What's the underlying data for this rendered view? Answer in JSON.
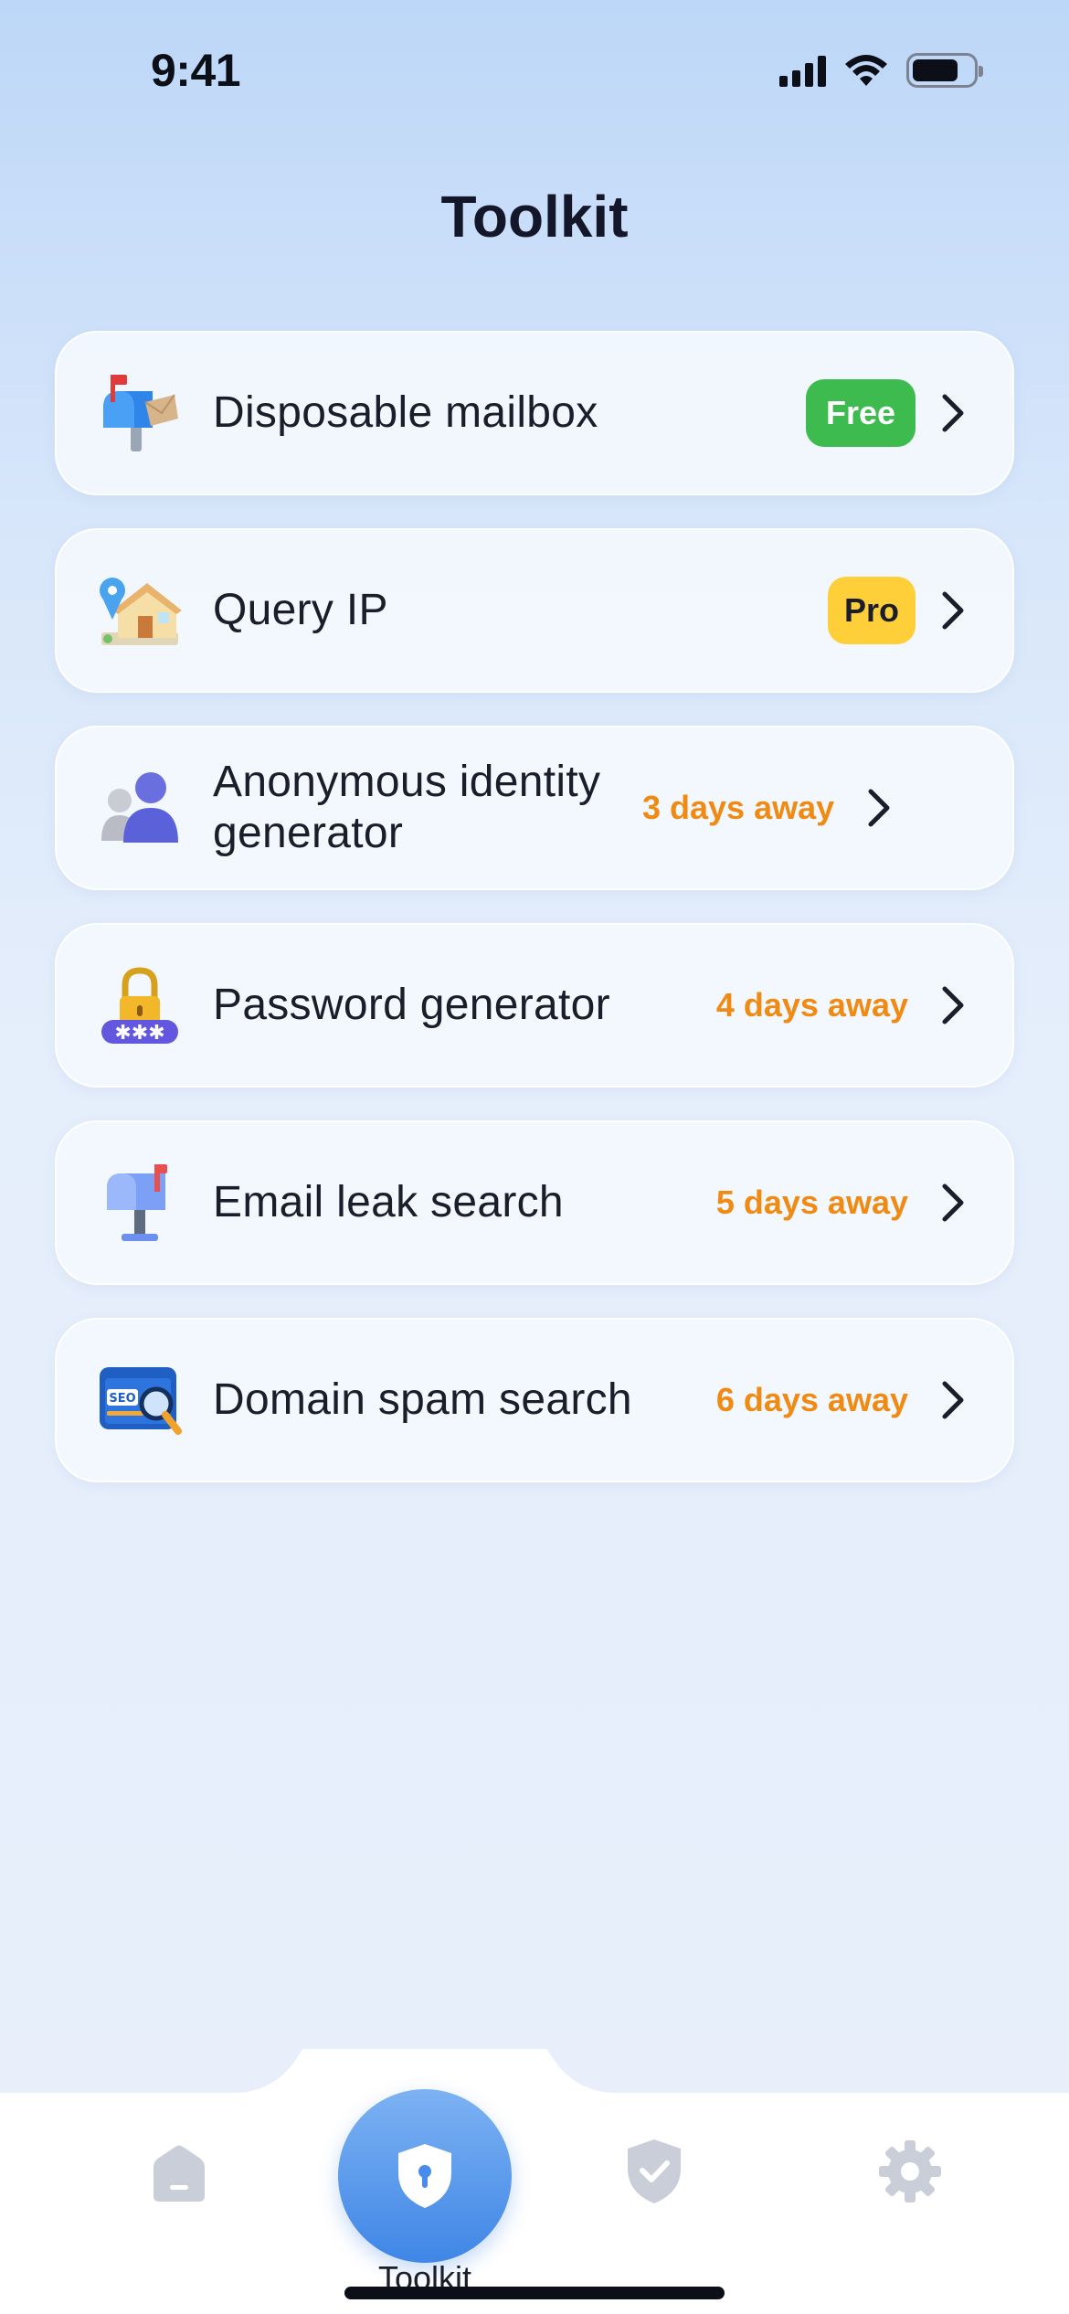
{
  "status_bar": {
    "time": "9:41"
  },
  "page": {
    "title": "Toolkit"
  },
  "tools": [
    {
      "label": "Disposable mailbox",
      "badge": "Free",
      "icon": "mailbox-icon"
    },
    {
      "label": "Query IP",
      "badge": "Pro",
      "icon": "house-location-icon"
    },
    {
      "label": "Anonymous identity generator",
      "status": "3 days away",
      "icon": "anonymous-people-icon"
    },
    {
      "label": "Password generator",
      "status": "4 days away",
      "icon": "padlock-password-icon"
    },
    {
      "label": "Email leak search",
      "status": "5 days away",
      "icon": "mailbox-flag-icon"
    },
    {
      "label": "Domain spam search",
      "status": "6 days away",
      "icon": "seo-search-icon"
    }
  ],
  "tab_bar": {
    "active_label": "Toolkit",
    "tabs": [
      "home-icon",
      "shield-keyhole-icon",
      "shield-check-icon",
      "gear-icon"
    ]
  },
  "colors": {
    "free_badge": "#3dbb4f",
    "pro_badge": "#ffcf3a",
    "days_away": "#f08a12",
    "accent": "#3f86e6"
  }
}
